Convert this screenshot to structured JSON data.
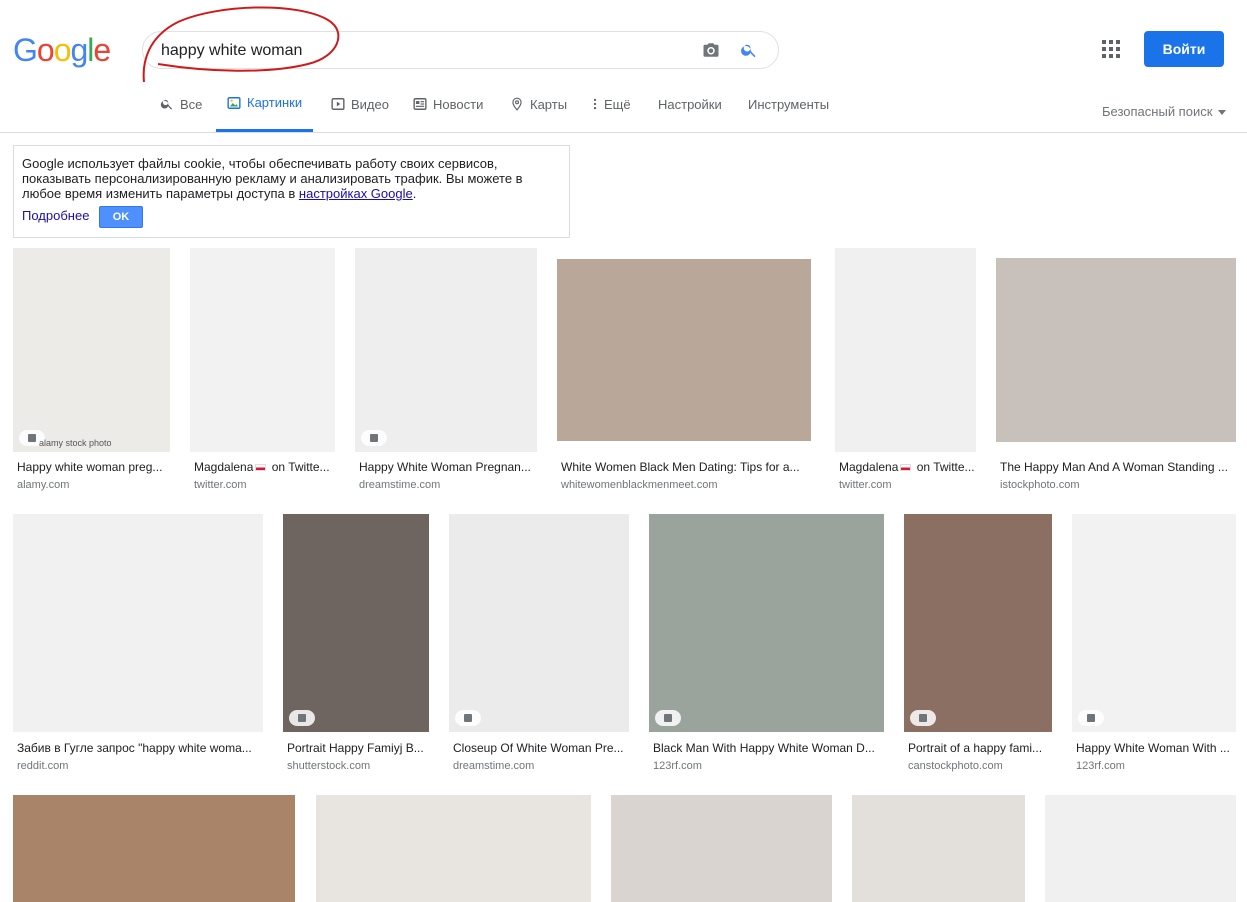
{
  "header": {
    "logo_letters": [
      {
        "ch": "G",
        "color": "#4285f4"
      },
      {
        "ch": "o",
        "color": "#ea4335"
      },
      {
        "ch": "o",
        "color": "#fbbc05"
      },
      {
        "ch": "g",
        "color": "#4285f4"
      },
      {
        "ch": "l",
        "color": "#34a853"
      },
      {
        "ch": "e",
        "color": "#ea4335"
      }
    ],
    "search_query": "happy white woman",
    "signin_label": "Войти",
    "annotation_color": "#d01a1a"
  },
  "tabs": [
    {
      "label": "Все",
      "icon": "search-icon"
    },
    {
      "label": "Картинки",
      "icon": "image-icon",
      "active": true
    },
    {
      "label": "Видео",
      "icon": "video-icon"
    },
    {
      "label": "Новости",
      "icon": "news-icon"
    },
    {
      "label": "Карты",
      "icon": "map-pin-icon"
    },
    {
      "label": "Ещё",
      "icon": "more-vert-icon"
    },
    {
      "label": "Настройки"
    },
    {
      "label": "Инструменты"
    }
  ],
  "safe_search": "Безопасный поиск",
  "cookie": {
    "text_before_link": "Google использует файлы cookie, чтобы обеспечивать работу своих сервисов, показывать персонализированную рекламу и анализировать трафик. Вы можете в любое время изменить параметры доступа в ",
    "link": "настройках Google",
    "text_after_link": ".",
    "more": "Подробнее",
    "ok": "OK"
  },
  "results": [
    {
      "title": "Happy white woman preg...",
      "source": "alamy.com",
      "bg": "#ecebe8",
      "badge": "image-icon",
      "caption": "alamy stock photo"
    },
    {
      "title_pre": "Magdalena",
      "title_post": " on Twitte...",
      "flag": true,
      "source": "twitter.com",
      "bg": "#f2f2f2"
    },
    {
      "title": "Happy White Woman Pregnan...",
      "source": "dreamstime.com",
      "bg": "#eeeeee",
      "badge": "image-icon"
    },
    {
      "title": "White Women Black Men Dating: Tips for a...",
      "source": "whitewomenblackmenmeet.com",
      "bg": "#b9a79a"
    },
    {
      "title_pre": "Magdalena",
      "title_post": " on Twitte...",
      "flag": true,
      "source": "twitter.com",
      "bg": "#f0f0f0"
    },
    {
      "title": "The Happy Man And A Woman Standing ...",
      "source": "istockphoto.com",
      "bg": "#c7c0bb"
    },
    {
      "title": "Забив в Гугле запрос \"happy white woma...",
      "source": "reddit.com",
      "bg": "#f1f1f1"
    },
    {
      "title": "Portrait Happy Famiyj B...",
      "source": "shutterstock.com",
      "bg": "#6e6460",
      "badge": "image-icon"
    },
    {
      "title": "Closeup Of White Woman Pre...",
      "source": "dreamstime.com",
      "bg": "#ebebeb",
      "badge": "image-icon"
    },
    {
      "title": "Black Man With Happy White Woman D...",
      "source": "123rf.com",
      "bg": "#9aa49c",
      "badge": "tag-icon"
    },
    {
      "title": "Portrait of a happy fami...",
      "source": "canstockphoto.com",
      "bg": "#8a6f62",
      "badge": "image-icon"
    },
    {
      "title": "Happy White Woman With ...",
      "source": "123rf.com",
      "bg": "#f2f2f2",
      "badge": "tag-icon"
    },
    {
      "bg": "#a98469"
    },
    {
      "bg": "#e8e4e0"
    },
    {
      "bg": "#d9d4cf"
    },
    {
      "bg": "#e3dfdb"
    },
    {
      "bg": "#f0f0f0"
    }
  ]
}
